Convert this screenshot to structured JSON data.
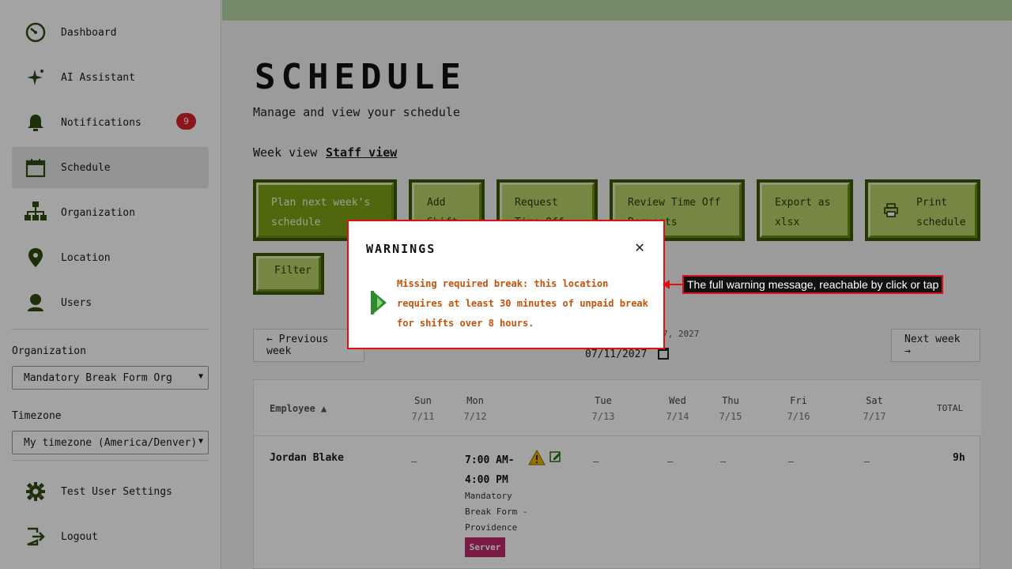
{
  "sidebar": {
    "nav": [
      {
        "label": "Dashboard",
        "icon": "dashboard-icon"
      },
      {
        "label": "AI Assistant",
        "icon": "sparkle-icon"
      },
      {
        "label": "Notifications",
        "icon": "bell-icon",
        "badge": "9"
      },
      {
        "label": "Schedule",
        "icon": "calendar-icon",
        "active": true
      },
      {
        "label": "Organization",
        "icon": "org-chart-icon"
      },
      {
        "label": "Location",
        "icon": "map-pin-icon"
      },
      {
        "label": "Users",
        "icon": "user-icon"
      }
    ],
    "organization_label": "Organization",
    "organization_value": "Mandatory Break Form Org",
    "timezone_label": "Timezone",
    "timezone_value": "My timezone (America/Denver)",
    "settings_label": "Test User Settings",
    "logout_label": "Logout"
  },
  "main": {
    "title": "SCHEDULE",
    "subtitle": "Manage and view your schedule",
    "tabs": [
      "Week view",
      "Staff view"
    ],
    "active_tab": "Staff view",
    "actions": [
      "Plan next week's schedule",
      "Add Shift",
      "Request Time Off",
      "Review Time Off Requests",
      "Export as xlsx",
      "Print schedule"
    ],
    "filter_label": "Filter",
    "prev_week": "← Previous week",
    "next_week": "Next week →",
    "date_caption": "7, 2027",
    "date_value": "07/11/2027"
  },
  "table": {
    "employee_header": "Employee ▲",
    "days": [
      {
        "name": "Sun",
        "date": "7/11"
      },
      {
        "name": "Mon",
        "date": "7/12"
      },
      {
        "name": "Tue",
        "date": "7/13"
      },
      {
        "name": "Wed",
        "date": "7/14"
      },
      {
        "name": "Thu",
        "date": "7/15"
      },
      {
        "name": "Fri",
        "date": "7/16"
      },
      {
        "name": "Sat",
        "date": "7/17"
      }
    ],
    "total_header": "TOTAL",
    "rows": [
      {
        "employee": "Jordan Blake",
        "empty": "–",
        "shift_time_1": "7:00 AM-",
        "shift_time_2": "4:00 PM",
        "shift_location": [
          "Mandatory",
          "Break Form -",
          "Providence"
        ],
        "role": "Server",
        "total": "9h"
      }
    ]
  },
  "modal": {
    "title": "WARNINGS",
    "warning_lines": [
      "Missing required break: this location",
      "requires at least 30 minutes of unpaid break",
      "for shifts over 8 hours."
    ]
  },
  "callout": "The full warning message, reachable by click or tap",
  "colors": {
    "accent_green": "#7ea315",
    "warning_text": "#c4520a",
    "badge_red": "#d8232a",
    "role_tag": "#c02870",
    "callout_border": "#dd1111"
  }
}
